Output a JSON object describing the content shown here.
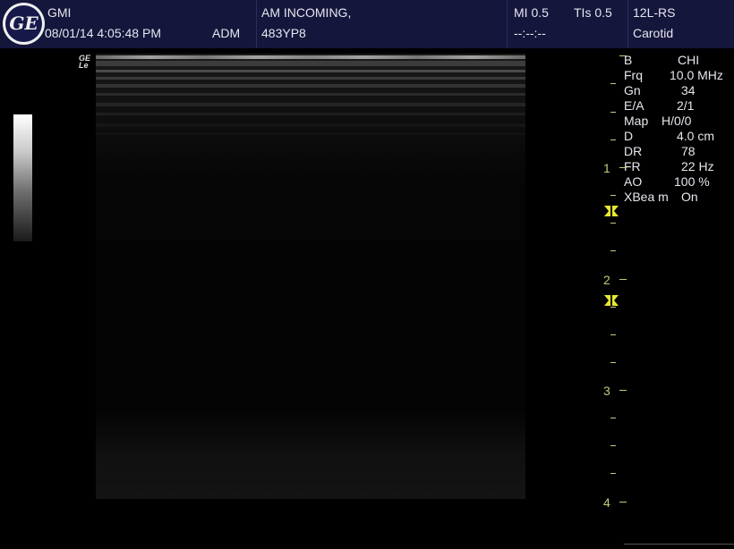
{
  "header": {
    "logo_text": "GE",
    "institution": "GMI",
    "datetime": "08/01/14 4:05:48 PM",
    "operator": "ADM",
    "patient_name": "AM INCOMING,",
    "patient_id": "483YP8",
    "mi_label": "MI 0.5",
    "tis_label": "TIs 0.5",
    "clock": "--:--:--",
    "probe": "12L-RS",
    "preset": "Carotid"
  },
  "image": {
    "ge_tag_line1": "GE",
    "ge_tag_line2": "Le"
  },
  "params": [
    {
      "label": "B",
      "value": "CHI"
    },
    {
      "label": "Frq",
      "value": "10.0 MHz"
    },
    {
      "label": "Gn",
      "value": "34"
    },
    {
      "label": "E/A",
      "value": "2/1"
    },
    {
      "label": "Map",
      "value": "H/0/0"
    },
    {
      "label": "D",
      "value": "4.0 cm"
    },
    {
      "label": "DR",
      "value": "78"
    },
    {
      "label": "FR",
      "value": "22 Hz"
    },
    {
      "label": "AO",
      "value": "100 %"
    },
    {
      "label": "XBea m",
      "value": "On"
    }
  ],
  "depth_scale": {
    "labels": [
      "1",
      "2",
      "3",
      "4"
    ],
    "unit": "cm",
    "color": "#c8c878"
  },
  "focus_marker_color": "#e8e832"
}
